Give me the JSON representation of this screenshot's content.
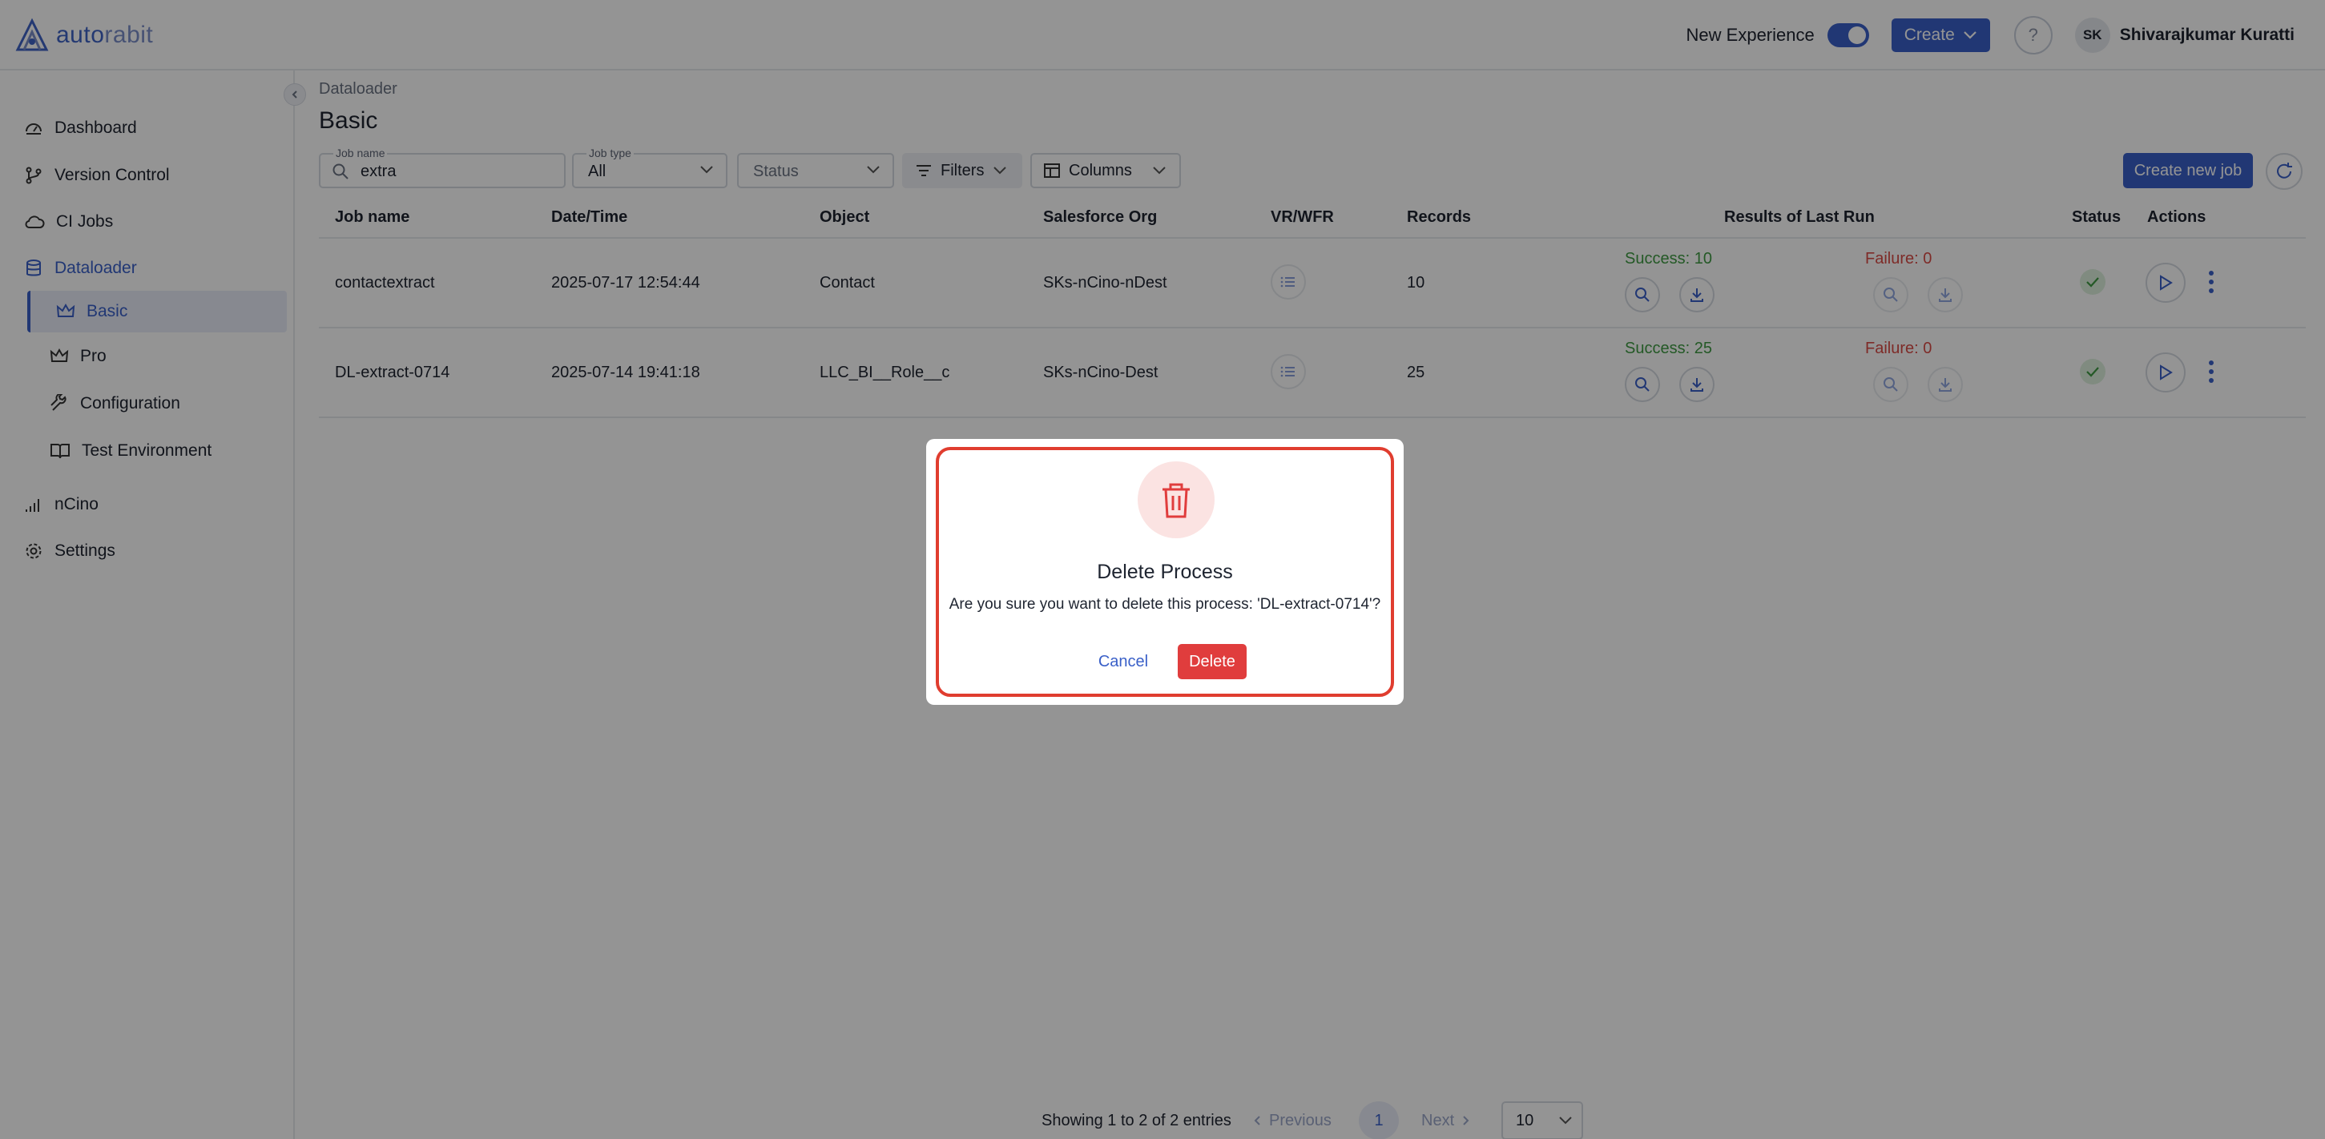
{
  "header": {
    "logo_prefix": "auto",
    "logo_suffix": "rabit",
    "new_experience_label": "New Experience",
    "new_experience_enabled": true,
    "create_label": "Create",
    "help_label": "?",
    "avatar_initials": "SK",
    "user_name": "Shivarajkumar Kuratti"
  },
  "sidebar": {
    "items": [
      {
        "label": "Dashboard",
        "icon": "dashboard-icon"
      },
      {
        "label": "Version Control",
        "icon": "branch-icon"
      },
      {
        "label": "CI Jobs",
        "icon": "cloud-icon"
      },
      {
        "label": "Dataloader",
        "icon": "database-icon"
      },
      {
        "label": "Basic",
        "icon": "crown-icon"
      },
      {
        "label": "Pro",
        "icon": "crown-icon"
      },
      {
        "label": "Configuration",
        "icon": "wrench-icon"
      },
      {
        "label": "Test Environment",
        "icon": "book-icon"
      },
      {
        "label": "nCino",
        "icon": "signal-icon"
      },
      {
        "label": "Settings",
        "icon": "gear-icon"
      }
    ]
  },
  "page": {
    "breadcrumb": "Dataloader",
    "title": "Basic"
  },
  "toolbar": {
    "job_name_label": "Job name",
    "job_name_value": "extra",
    "job_type_label": "Job type",
    "job_type_value": "All",
    "status_placeholder": "Status",
    "filters_label": "Filters",
    "columns_label": "Columns",
    "create_job_label": "Create new job"
  },
  "table": {
    "headers": [
      "Job name",
      "Date/Time",
      "Object",
      "Salesforce Org",
      "VR/WFR",
      "Records",
      "Results of Last Run",
      "Status",
      "Actions"
    ],
    "rows": [
      {
        "job_name": "contactextract",
        "datetime": "2025-07-17 12:54:44",
        "object": "Contact",
        "org": "SKs-nCino-nDest",
        "records": "10",
        "success": "Success: 10",
        "failure": "Failure: 0"
      },
      {
        "job_name": "DL-extract-0714",
        "datetime": "2025-07-14 19:41:18",
        "object": "LLC_BI__Role__c",
        "org": "SKs-nCino-Dest",
        "records": "25",
        "success": "Success: 25",
        "failure": "Failure: 0"
      }
    ]
  },
  "pagination": {
    "summary": "Showing 1 to 2 of 2 entries",
    "previous": "Previous",
    "current_page": "1",
    "next": "Next",
    "page_size": "10"
  },
  "modal": {
    "title": "Delete Process",
    "message": "Are you sure you want to delete this process: 'DL-extract-0714'?",
    "cancel": "Cancel",
    "delete": "Delete"
  },
  "colors": {
    "accent": "#3a60c8",
    "success": "#3e9a43",
    "failure": "#d94b45",
    "danger": "#e03d3d"
  }
}
